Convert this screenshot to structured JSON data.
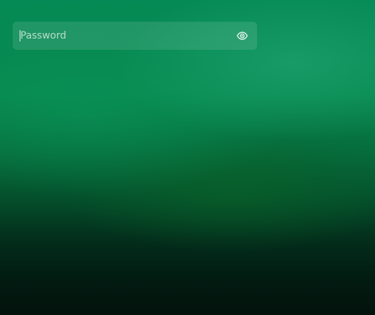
{
  "password_field": {
    "value": "",
    "placeholder": "Password",
    "reveal_icon": "eye-icon"
  }
}
